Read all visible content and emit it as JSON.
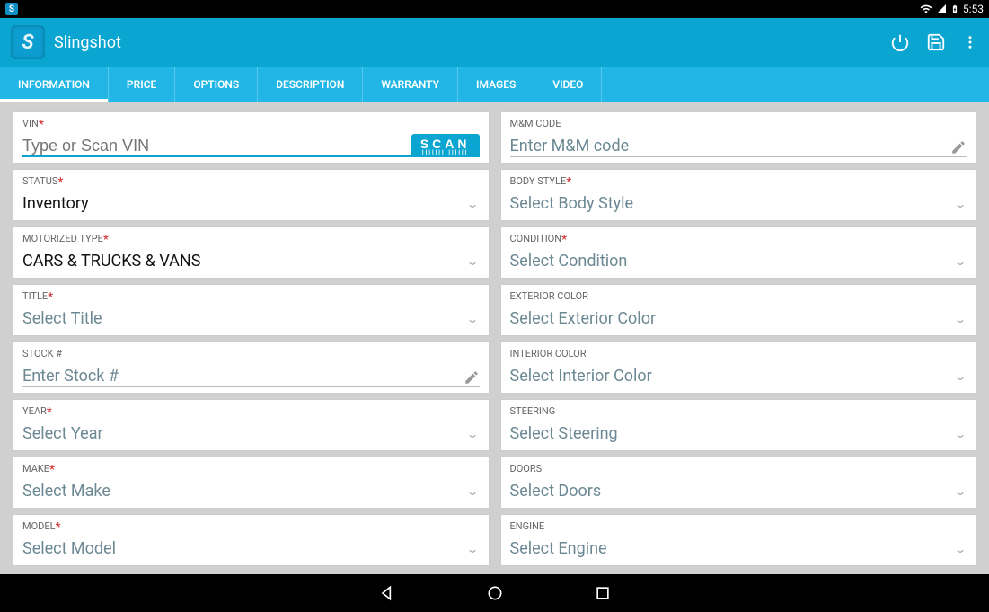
{
  "status": {
    "time": "5:53"
  },
  "app": {
    "title": "Slingshot"
  },
  "tabs": [
    {
      "label": "INFORMATION",
      "active": true
    },
    {
      "label": "PRICE"
    },
    {
      "label": "OPTIONS"
    },
    {
      "label": "DESCRIPTION"
    },
    {
      "label": "WARRANTY"
    },
    {
      "label": "IMAGES"
    },
    {
      "label": "VIDEO"
    }
  ],
  "fields": {
    "vin": {
      "label": "VIN",
      "required": true,
      "placeholder": "Type or Scan VIN",
      "scan": "SCAN"
    },
    "mm": {
      "label": "M&M CODE",
      "placeholder": "Enter M&M code",
      "icon": "pencil"
    },
    "status": {
      "label": "STATUS",
      "required": true,
      "value": "Inventory",
      "dropdown": true
    },
    "body": {
      "label": "BODY STYLE",
      "required": true,
      "placeholder": "Select Body Style",
      "dropdown": true
    },
    "motor": {
      "label": "MOTORIZED TYPE",
      "required": true,
      "value": "CARS & TRUCKS & VANS",
      "dropdown": true
    },
    "condition": {
      "label": "CONDITION",
      "required": true,
      "placeholder": "Select Condition",
      "dropdown": true
    },
    "title": {
      "label": "TITLE",
      "required": true,
      "placeholder": "Select Title",
      "dropdown": true
    },
    "extcolor": {
      "label": "EXTERIOR COLOR",
      "placeholder": "Select Exterior Color",
      "dropdown": true
    },
    "stock": {
      "label": "STOCK #",
      "placeholder": "Enter Stock #",
      "icon": "pencil"
    },
    "intcolor": {
      "label": "INTERIOR COLOR",
      "placeholder": "Select Interior Color",
      "dropdown": true
    },
    "year": {
      "label": "YEAR",
      "required": true,
      "placeholder": "Select Year",
      "dropdown": true
    },
    "steering": {
      "label": "STEERING",
      "placeholder": "Select Steering",
      "dropdown": true
    },
    "make": {
      "label": "MAKE",
      "required": true,
      "placeholder": "Select Make",
      "dropdown": true
    },
    "doors": {
      "label": "DOORS",
      "placeholder": "Select Doors",
      "dropdown": true
    },
    "model": {
      "label": "MODEL",
      "required": true,
      "placeholder": "Select Model",
      "dropdown": true
    },
    "engine": {
      "label": "ENGINE",
      "placeholder": "Select Engine",
      "dropdown": true
    }
  }
}
